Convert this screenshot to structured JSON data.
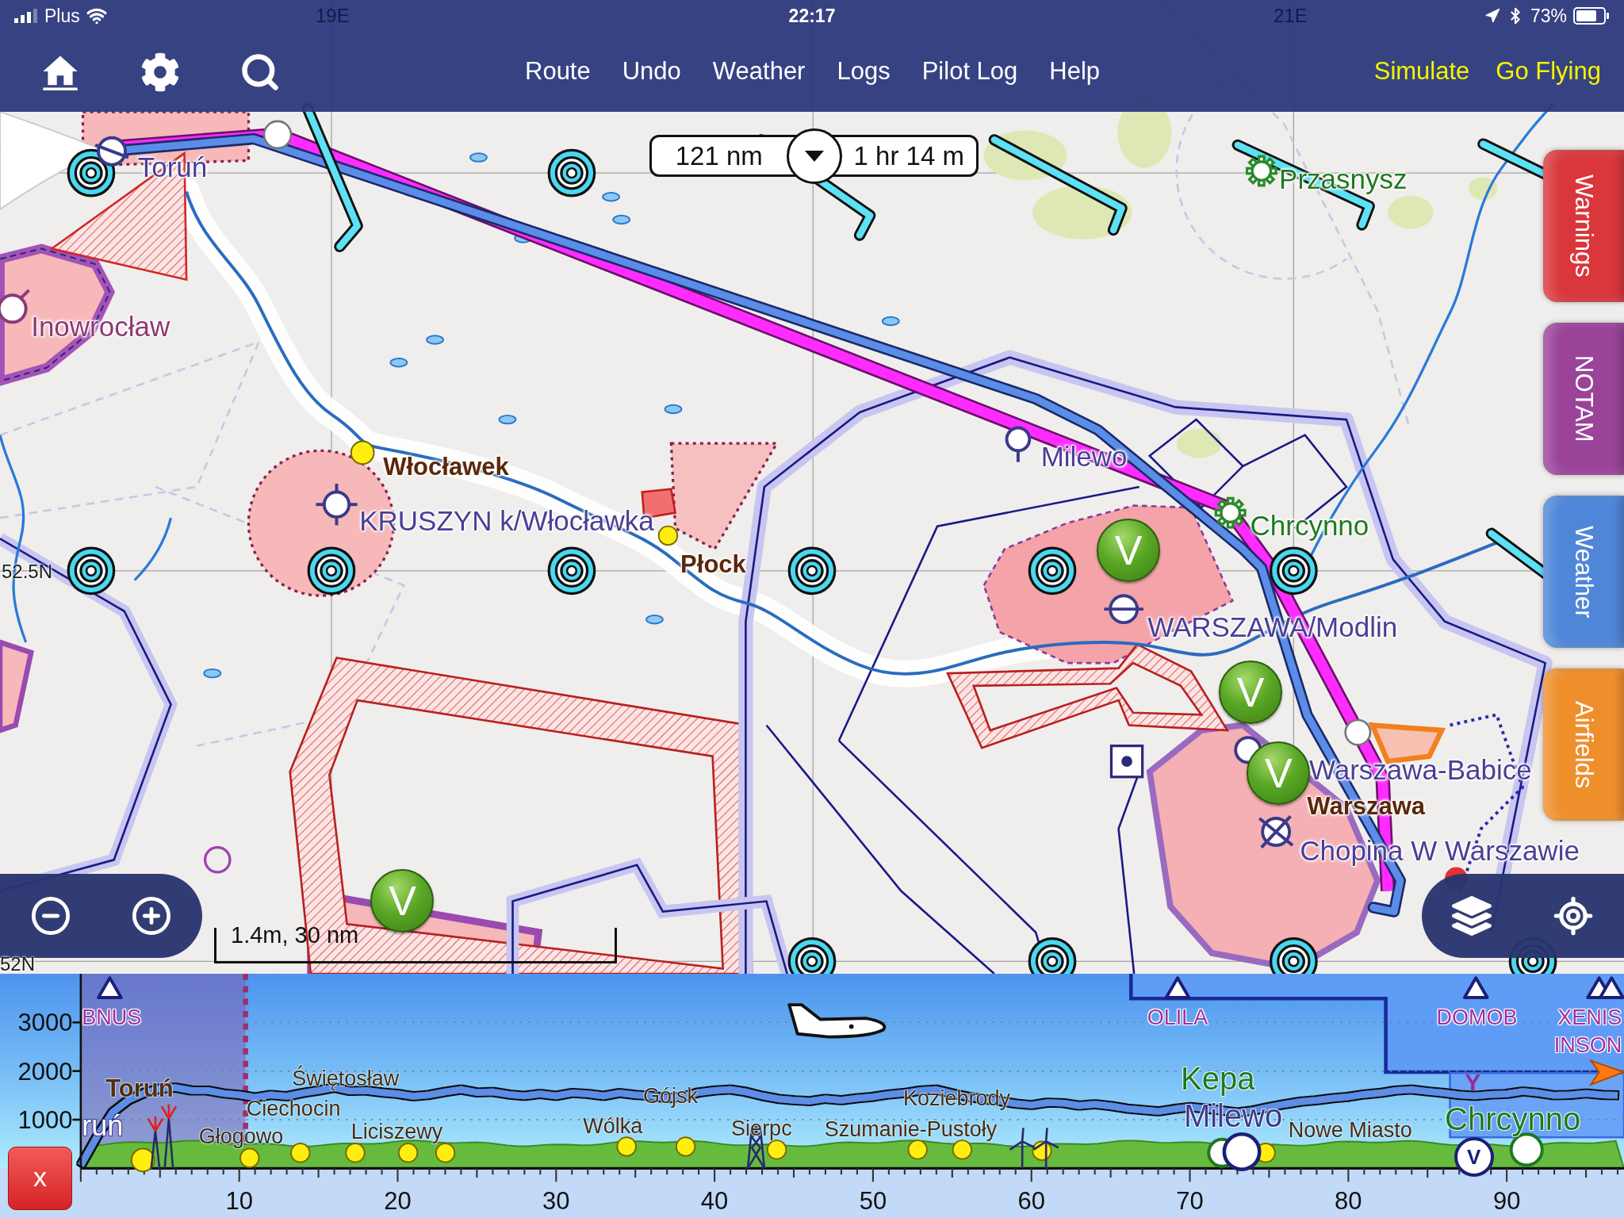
{
  "status_bar": {
    "carrier": "Plus",
    "time": "22:17",
    "battery": "73%"
  },
  "grid_labels": [
    "19E",
    "21E",
    "52.5N",
    "52N"
  ],
  "toolbar": {
    "menu": [
      "Route",
      "Undo",
      "Weather",
      "Logs",
      "Pilot Log",
      "Help"
    ],
    "actions": [
      "Simulate",
      "Go Flying"
    ]
  },
  "route_summary": {
    "distance": "121 nm",
    "duration": "1 hr 14 m"
  },
  "side_tabs": [
    {
      "label": "Warnings",
      "color": "#d9373c"
    },
    {
      "label": "NOTAM",
      "color": "#9a4399"
    },
    {
      "label": "Weather",
      "color": "#4f86d8"
    },
    {
      "label": "Airfields",
      "color": "#ef8f2c"
    }
  ],
  "map": {
    "places": [
      {
        "name": "Toruń",
        "kind": "airfield"
      },
      {
        "name": "Inowrocław",
        "kind": "military"
      },
      {
        "name": "Włocławek",
        "kind": "town"
      },
      {
        "name": "KRUSZYN k/Włocławka",
        "kind": "airfield"
      },
      {
        "name": "Płock",
        "kind": "town"
      },
      {
        "name": "Przasnysz",
        "kind": "glider"
      },
      {
        "name": "Milewo",
        "kind": "airfield"
      },
      {
        "name": "Chrcynno",
        "kind": "glider"
      },
      {
        "name": "WARSZAWA/Modlin",
        "kind": "airfield"
      },
      {
        "name": "Warszawa-Babice",
        "kind": "airfield"
      },
      {
        "name": "Warszawa",
        "kind": "town"
      },
      {
        "name": "Chopina W Warszawie",
        "kind": "airfield"
      }
    ],
    "markers": [
      "V",
      "V",
      "V",
      "V"
    ],
    "scale": "1.4m, 30 nm"
  },
  "profile": {
    "chart_data": {
      "type": "line",
      "x": [
        0,
        1,
        2,
        3,
        4,
        5,
        6,
        7,
        8,
        9,
        10,
        11,
        12,
        13,
        14,
        15,
        16,
        17,
        18,
        19,
        20,
        21,
        22,
        23,
        24,
        25,
        26,
        27,
        28,
        29,
        30,
        31,
        32,
        33,
        34,
        35,
        36,
        37,
        38,
        39,
        40,
        41,
        42,
        43,
        44,
        45,
        46,
        47,
        48,
        49,
        50,
        51,
        52,
        53,
        54,
        55,
        56,
        57,
        58,
        59,
        60,
        61,
        62,
        63,
        64,
        65,
        66,
        67,
        68,
        69,
        70,
        71,
        72,
        73,
        74,
        75,
        76,
        77,
        78,
        79,
        80,
        81,
        82,
        83,
        84,
        85,
        86,
        87,
        88,
        89,
        90,
        91,
        92,
        93,
        94,
        95,
        96,
        97
      ],
      "values": [
        60,
        640,
        1150,
        1400,
        1550,
        1640,
        1660,
        1600,
        1600,
        1540,
        1510,
        1460,
        1510,
        1480,
        1550,
        1600,
        1660,
        1590,
        1600,
        1560,
        1530,
        1480,
        1510,
        1570,
        1620,
        1560,
        1570,
        1520,
        1490,
        1530,
        1490,
        1550,
        1530,
        1490,
        1550,
        1510,
        1490,
        1440,
        1470,
        1560,
        1600,
        1620,
        1570,
        1490,
        1430,
        1400,
        1380,
        1430,
        1400,
        1440,
        1470,
        1520,
        1550,
        1600,
        1620,
        1540,
        1470,
        1420,
        1380,
        1330,
        1300,
        1350,
        1340,
        1290,
        1320,
        1280,
        1230,
        1200,
        1170,
        1220,
        1260,
        1230,
        1190,
        1150,
        1190,
        1260,
        1320,
        1370,
        1400,
        1440,
        1470,
        1520,
        1550,
        1600,
        1620,
        1580,
        1550,
        1510,
        1490,
        1520,
        1530,
        1580,
        1550,
        1500,
        1510,
        1540,
        1510,
        1500
      ],
      "xlim": [
        0,
        97.4
      ],
      "ylim": [
        0,
        4000
      ],
      "xticks": [
        10,
        20,
        30,
        40,
        50,
        60,
        70,
        80,
        90
      ],
      "yticks": [
        1000,
        2000,
        3000
      ],
      "grid": true,
      "ref_lines": [
        {
          "axis": "x",
          "value": 10.4
        }
      ],
      "bands": [
        {
          "axis": "x",
          "from": 0,
          "to": 10.4
        }
      ]
    },
    "waypoints": [
      "BNUS",
      "OLILA",
      "DOMOB",
      "XENIS",
      "INSON"
    ],
    "places": [
      {
        "name": "Toruń",
        "kind": "town-major"
      },
      {
        "name": "ruń",
        "kind": "airfield-edge"
      },
      {
        "name": "Świętosław",
        "kind": "town"
      },
      {
        "name": "Ciechocin",
        "kind": "town"
      },
      {
        "name": "Głogowo",
        "kind": "town"
      },
      {
        "name": "Liciszewy",
        "kind": "town"
      },
      {
        "name": "Wólka",
        "kind": "town"
      },
      {
        "name": "Gójsk",
        "kind": "town"
      },
      {
        "name": "Sierpc",
        "kind": "town"
      },
      {
        "name": "Koziebrody",
        "kind": "town"
      },
      {
        "name": "Szumanie-Pustoły",
        "kind": "town"
      },
      {
        "name": "Kepa",
        "kind": "glider"
      },
      {
        "name": "Milewo",
        "kind": "airfield"
      },
      {
        "name": "Nowe Miasto",
        "kind": "town"
      },
      {
        "name": "Chrcynno",
        "kind": "glider"
      }
    ],
    "marks": [
      {
        "label": "Y",
        "kind": "letter"
      },
      {
        "label": "V",
        "kind": "circled"
      }
    ],
    "close_button": "x"
  }
}
